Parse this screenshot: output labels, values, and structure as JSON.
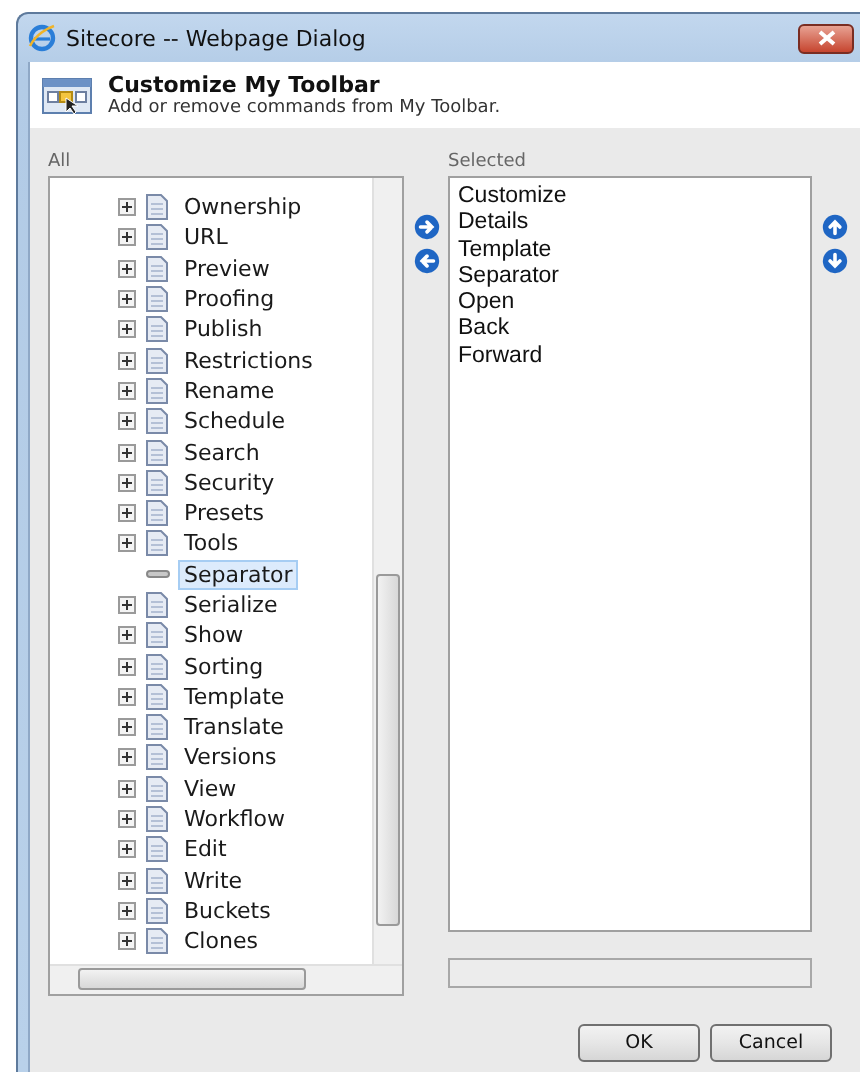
{
  "window": {
    "title": "Sitecore -- Webpage Dialog"
  },
  "header": {
    "title": "Customize My Toolbar",
    "subtitle": "Add or remove commands from My Toolbar."
  },
  "all_panel": {
    "label": "All",
    "items": [
      {
        "label": "Ownership",
        "kind": "command",
        "selected": false
      },
      {
        "label": "URL",
        "kind": "command",
        "selected": false
      },
      {
        "label": "Preview",
        "kind": "command",
        "selected": false
      },
      {
        "label": "Proofing",
        "kind": "command",
        "selected": false
      },
      {
        "label": "Publish",
        "kind": "command",
        "selected": false
      },
      {
        "label": "Restrictions",
        "kind": "command",
        "selected": false
      },
      {
        "label": "Rename",
        "kind": "command",
        "selected": false
      },
      {
        "label": "Schedule",
        "kind": "command",
        "selected": false
      },
      {
        "label": "Search",
        "kind": "command",
        "selected": false
      },
      {
        "label": "Security",
        "kind": "command",
        "selected": false
      },
      {
        "label": "Presets",
        "kind": "command",
        "selected": false
      },
      {
        "label": "Tools",
        "kind": "command",
        "selected": false
      },
      {
        "label": "Separator",
        "kind": "separator",
        "selected": true
      },
      {
        "label": "Serialize",
        "kind": "command",
        "selected": false
      },
      {
        "label": "Show",
        "kind": "command",
        "selected": false
      },
      {
        "label": "Sorting",
        "kind": "command",
        "selected": false
      },
      {
        "label": "Template",
        "kind": "command",
        "selected": false
      },
      {
        "label": "Translate",
        "kind": "command",
        "selected": false
      },
      {
        "label": "Versions",
        "kind": "command",
        "selected": false
      },
      {
        "label": "View",
        "kind": "command",
        "selected": false
      },
      {
        "label": "Workflow",
        "kind": "command",
        "selected": false
      },
      {
        "label": "Edit",
        "kind": "command",
        "selected": false
      },
      {
        "label": "Write",
        "kind": "command",
        "selected": false
      },
      {
        "label": "Buckets",
        "kind": "command",
        "selected": false
      },
      {
        "label": "Clones",
        "kind": "command",
        "selected": false
      }
    ]
  },
  "selected_panel": {
    "label": "Selected",
    "items": [
      "Customize",
      "Details",
      "Template",
      "Separator",
      "Open",
      "Back",
      "Forward"
    ]
  },
  "buttons": [
    "OK",
    "Cancel"
  ]
}
